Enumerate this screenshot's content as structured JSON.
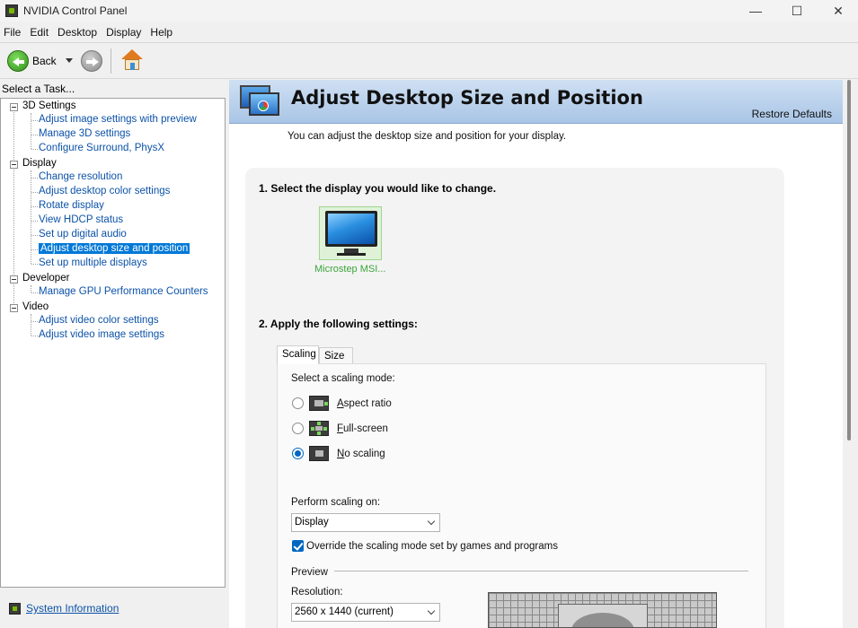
{
  "window": {
    "title": "NVIDIA Control Panel"
  },
  "menu": [
    "File",
    "Edit",
    "Desktop",
    "Display",
    "Help"
  ],
  "toolbar": {
    "back_label": "Back"
  },
  "task_panel": {
    "header": "Select a Task...",
    "tree": [
      {
        "label": "3D Settings",
        "children": [
          "Adjust image settings with preview",
          "Manage 3D settings",
          "Configure Surround, PhysX"
        ]
      },
      {
        "label": "Display",
        "children": [
          "Change resolution",
          "Adjust desktop color settings",
          "Rotate display",
          "View HDCP status",
          "Set up digital audio",
          "Adjust desktop size and position",
          "Set up multiple displays"
        ]
      },
      {
        "label": "Developer",
        "children": [
          "Manage GPU Performance Counters"
        ]
      },
      {
        "label": "Video",
        "children": [
          "Adjust video color settings",
          "Adjust video image settings"
        ]
      }
    ],
    "selected": "Adjust desktop size and position",
    "system_info": "System Information"
  },
  "page": {
    "title": "Adjust Desktop Size and Position",
    "restore_defaults": "Restore Defaults",
    "description": "You can adjust the desktop size and position for your display.",
    "section1": "1. Select the display you would like to change.",
    "display_name": "Microstep MSI...",
    "section2": "2. Apply the following settings:",
    "tabs": [
      "Scaling",
      "Size"
    ],
    "active_tab": "Scaling",
    "scaling_mode_label": "Select a scaling mode:",
    "scaling_modes": [
      {
        "accel": "A",
        "rest": "spect ratio",
        "selected": false
      },
      {
        "accel": "F",
        "rest": "ull-screen",
        "selected": false
      },
      {
        "accel": "N",
        "rest": "o scaling",
        "selected": true
      }
    ],
    "perform_scaling_label": "Perform scaling on:",
    "perform_scaling_value": "Display",
    "override_label": "Override the scaling mode set by games and programs",
    "override_checked": true,
    "preview_label": "Preview",
    "resolution_label": "Resolution:",
    "resolution_value": "2560 x 1440 (current)"
  },
  "colors": {
    "accent": "#0078d7",
    "link": "#0c52a8",
    "nvidia_green": "#76b900",
    "banner": "#a9c5e6"
  }
}
